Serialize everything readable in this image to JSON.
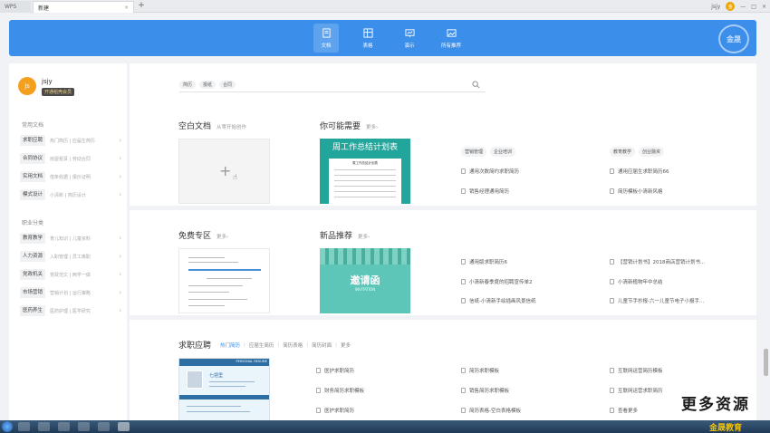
{
  "titlebar": {
    "app_tab": "WPS",
    "doc_tab": "新建",
    "close_glyph": "×",
    "add_glyph": "+",
    "user_label": "jsjy",
    "avatar_text": "金"
  },
  "topnav": {
    "items": [
      {
        "label": "文档",
        "icon": "doc-icon",
        "active": true
      },
      {
        "label": "表格",
        "icon": "table-icon",
        "active": false
      },
      {
        "label": "演示",
        "icon": "presentation-icon",
        "active": false
      },
      {
        "label": "所有推荐",
        "icon": "image-icon",
        "active": false
      }
    ],
    "logo_glyph": "金晟",
    "accent": "#3b8eea"
  },
  "sidebar": {
    "user": {
      "avatar": "js",
      "name": "jsjy",
      "badge": "开通稻壳会员"
    },
    "section1": "常用文档",
    "common": [
      {
        "label": "求职应聘",
        "sub": "热门简历 | 应届生简历"
      },
      {
        "label": "合同协议",
        "sub": "房屋租赁 | 劳动合同"
      },
      {
        "label": "实用文档",
        "sub": "借条收据 | 报价证明"
      },
      {
        "label": "模式设计",
        "sub": "小清新 | 简历设计"
      }
    ],
    "section2": "职业分类",
    "careers": [
      {
        "label": "教育教学",
        "sub": "育儿知识 | 儿童资料"
      },
      {
        "label": "人力资源",
        "sub": "入职管理 | 员工离职"
      },
      {
        "label": "党政机关",
        "sub": "党政范文 | 两学一做"
      },
      {
        "label": "市场营销",
        "sub": "营销计划 | 运行策略"
      },
      {
        "label": "医药养生",
        "sub": "医药护理 | 医学研究"
      }
    ],
    "arrow": "›"
  },
  "search": {
    "chips": [
      "简历",
      "报纸",
      "合同"
    ]
  },
  "blank": {
    "title": "空白文档",
    "sub": "从零开始创作",
    "plus": "+",
    "cursor": "☝"
  },
  "maybe": {
    "title": "你可能需要",
    "more": "更多›",
    "card_title": "周工作总结计划表",
    "card_sheet_title": "周工作总结计划表",
    "tags_a": [
      "营销管理",
      "企业培训"
    ],
    "tags_b": [
      "教育教学",
      "创业融资"
    ],
    "links_a": [
      "通用次数简约求职简历",
      "销售经理通用简历"
    ],
    "links_b": [
      "通用应届生求职简历66",
      "简历模板小清新风格"
    ]
  },
  "free": {
    "title": "免费专区",
    "more": "更多›"
  },
  "new_items": {
    "title": "新品推荐",
    "more": "更多›",
    "card_title": "邀请函",
    "card_sub": "INVITATION",
    "links_a": [
      "通用版求职简历6",
      "小清新春季度的招聘宣传单2",
      "信纸-小清新手绘插画风景信纸"
    ],
    "links_b": [
      "【营销计划书】2018商店营销计划书...",
      "小清新植物年中总结",
      "儿童节手抄报-六一儿童节电子小报手..."
    ]
  },
  "jobs": {
    "title": "求职应聘",
    "tabs": [
      "热门简历",
      "应届生简历",
      "简历表格",
      "简历封面",
      "更多"
    ],
    "card_header": "PERSONAL RESUME",
    "card_name": "七把里",
    "col_a": [
      "医护求职简历",
      "财务简历求职模板",
      "医护求职简历"
    ],
    "col_b": [
      "简历求职模板",
      "销售简历求职模板",
      "简历表格-空白表格模板"
    ],
    "col_c": [
      "互联网运营简历模板",
      "互联网运营求职简历",
      "查看更多"
    ]
  },
  "watermark": {
    "text": "更多资源",
    "brand": "金晟教育"
  }
}
